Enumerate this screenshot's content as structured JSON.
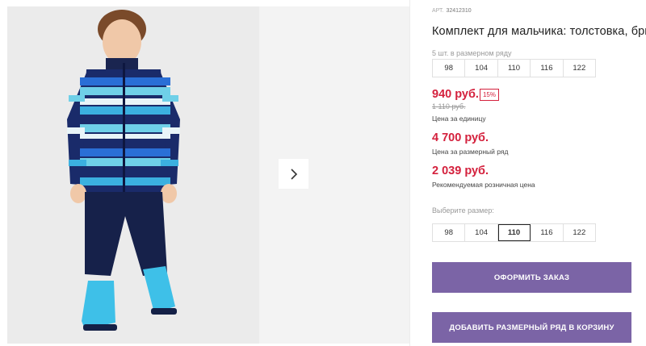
{
  "gallery": {
    "next_icon": "chevron-right-icon"
  },
  "product": {
    "sku_label": "АРТ.",
    "sku": "32412310",
    "title": "Комплект для мальчика: толстовка, брюки",
    "pack_hint": "5 шт. в размерном ряду",
    "pack_sizes": [
      "98",
      "104",
      "110",
      "116",
      "122"
    ],
    "price": "940 руб.",
    "discount": "15%",
    "old_price": "1 110 руб.",
    "price_caption": "Цена за единицу",
    "pack_price": "4 700 руб.",
    "pack_price_caption": "Цена за размерный ряд",
    "retail_price": "2 039 руб.",
    "retail_price_caption": "Рекомендуемая розничная цена",
    "size_select_hint": "Выберите размер:",
    "select_sizes": [
      "98",
      "104",
      "110",
      "116",
      "122"
    ],
    "selected_size": "110"
  },
  "actions": {
    "order_label": "ОФОРМИТЬ ЗАКАЗ",
    "add_to_cart_label": "ДОБАВИТЬ РАЗМЕРНЫЙ РЯД В КОРЗИНУ"
  },
  "colors": {
    "accent": "#7b64a6",
    "price": "#d4213d"
  }
}
